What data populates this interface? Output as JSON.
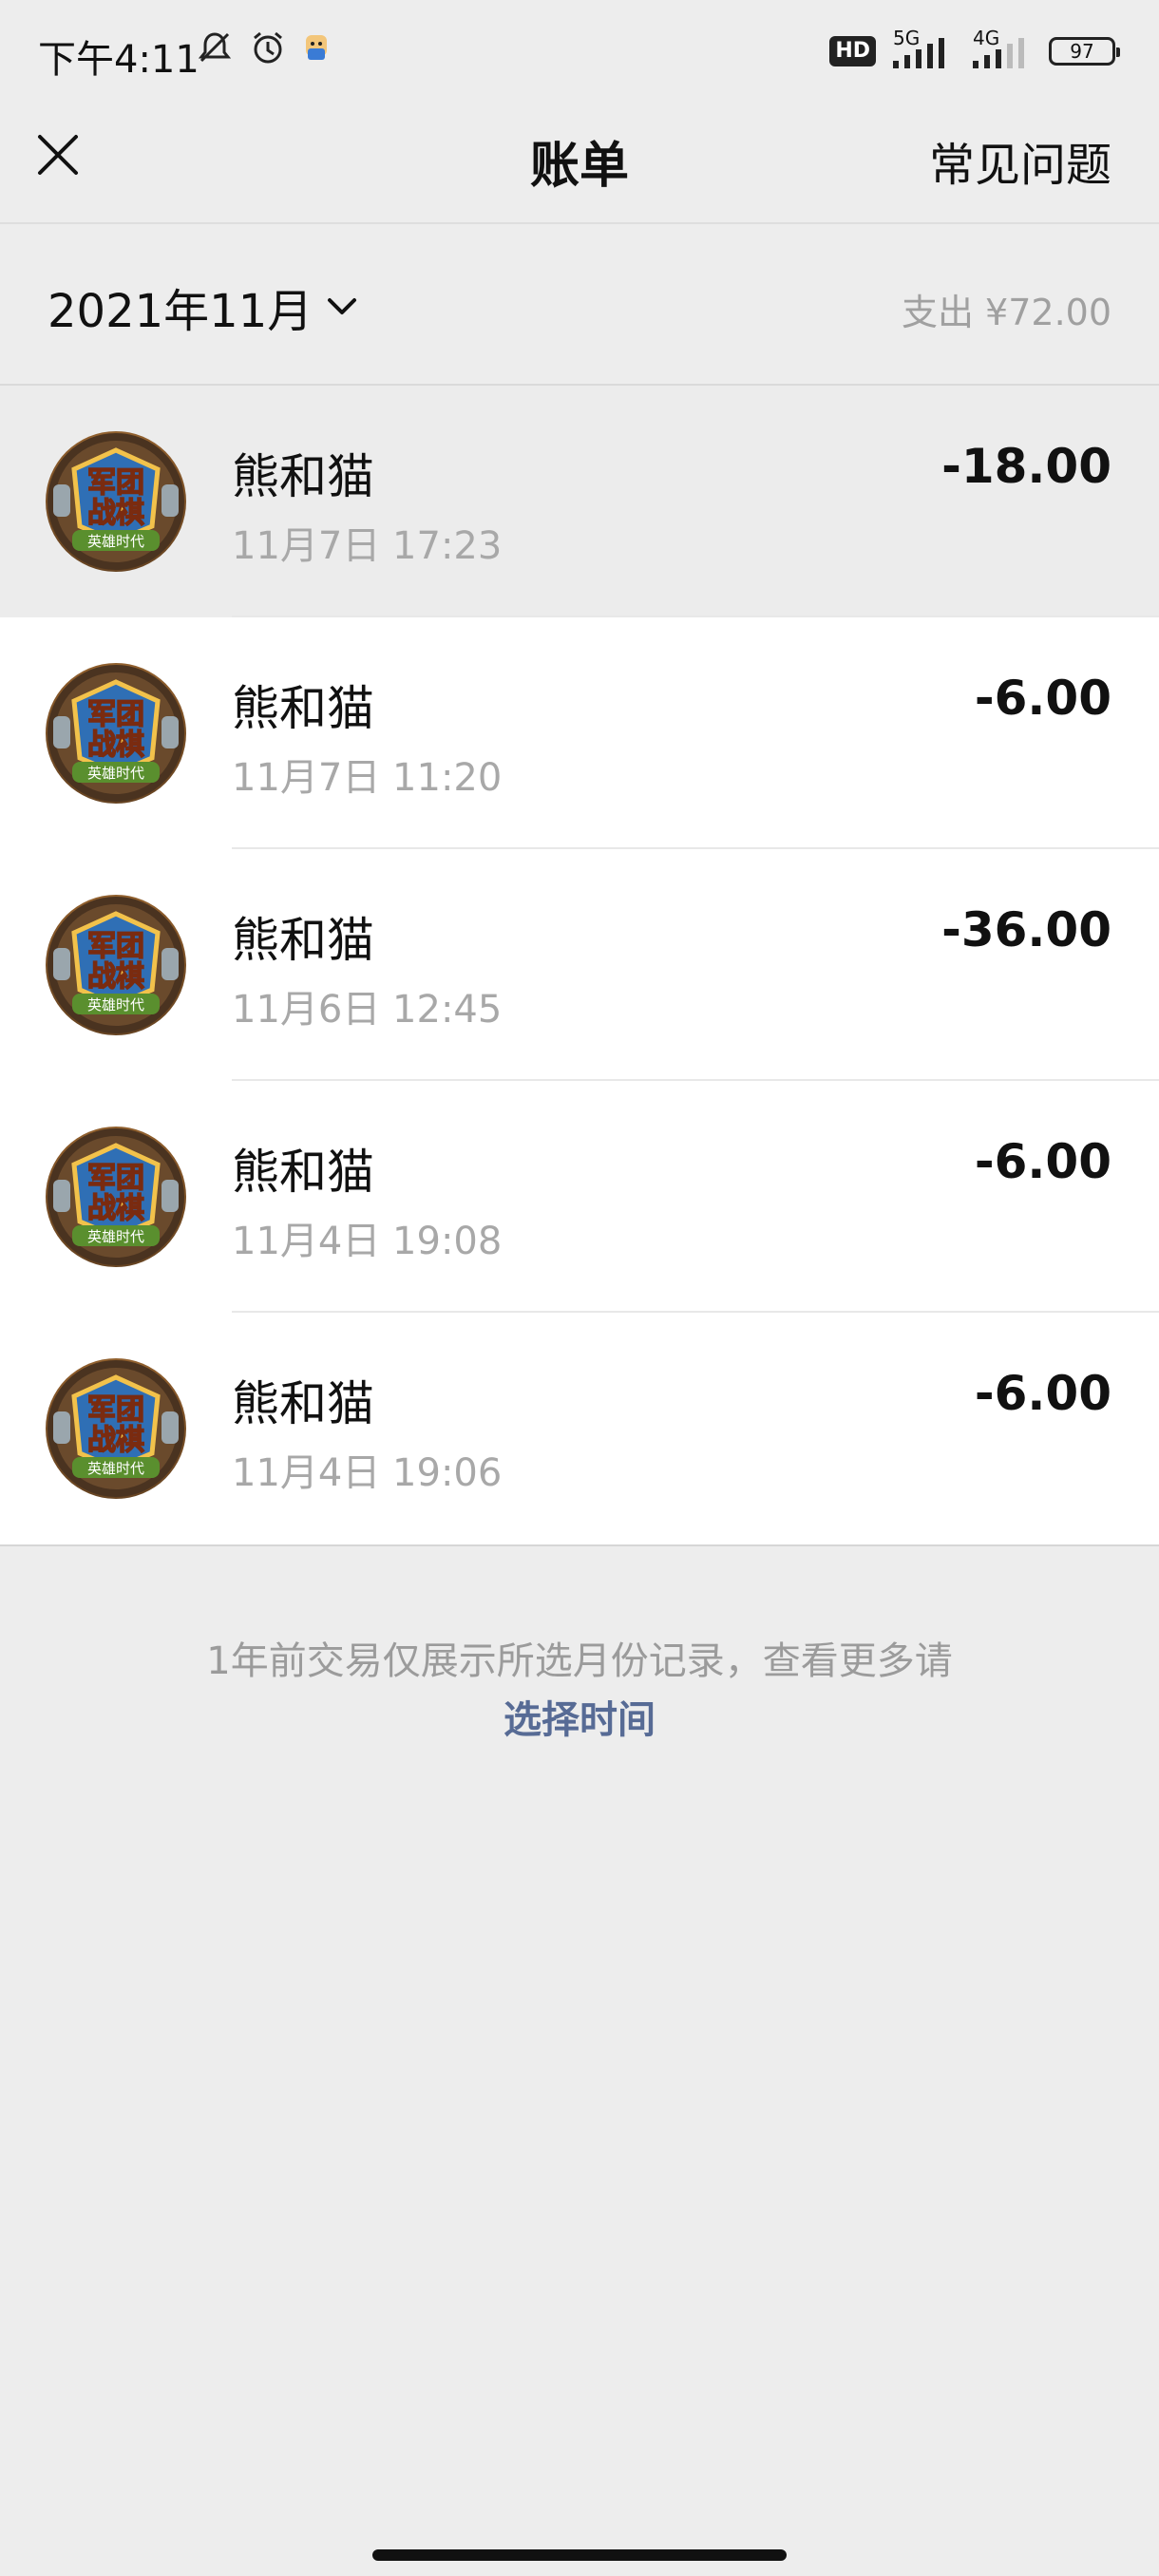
{
  "status_bar": {
    "time": "下午4:11",
    "hd_label": "HD",
    "net_5g": "5G",
    "net_4g": "4G",
    "battery": "97"
  },
  "nav": {
    "title": "账单",
    "faq": "常见问题"
  },
  "header": {
    "month": "2021年11月",
    "total": "支出 ¥72.00"
  },
  "transactions": [
    {
      "name": "熊和猫",
      "time": "11月7日 17:23",
      "amount": "-18.00"
    },
    {
      "name": "熊和猫",
      "time": "11月7日 11:20",
      "amount": "-6.00"
    },
    {
      "name": "熊和猫",
      "time": "11月6日 12:45",
      "amount": "-36.00"
    },
    {
      "name": "熊和猫",
      "time": "11月4日 19:08",
      "amount": "-6.00"
    },
    {
      "name": "熊和猫",
      "time": "11月4日 19:06",
      "amount": "-6.00"
    }
  ],
  "avatar_text": {
    "line1": "军团",
    "line2": "战棋",
    "banner": "英雄时代"
  },
  "footer": {
    "note": "1年前交易仅展示所选月份记录，查看更多请",
    "link": "选择时间"
  },
  "colors": {
    "link": "#576b95",
    "muted": "#a8a8a8",
    "background": "#ededed"
  }
}
